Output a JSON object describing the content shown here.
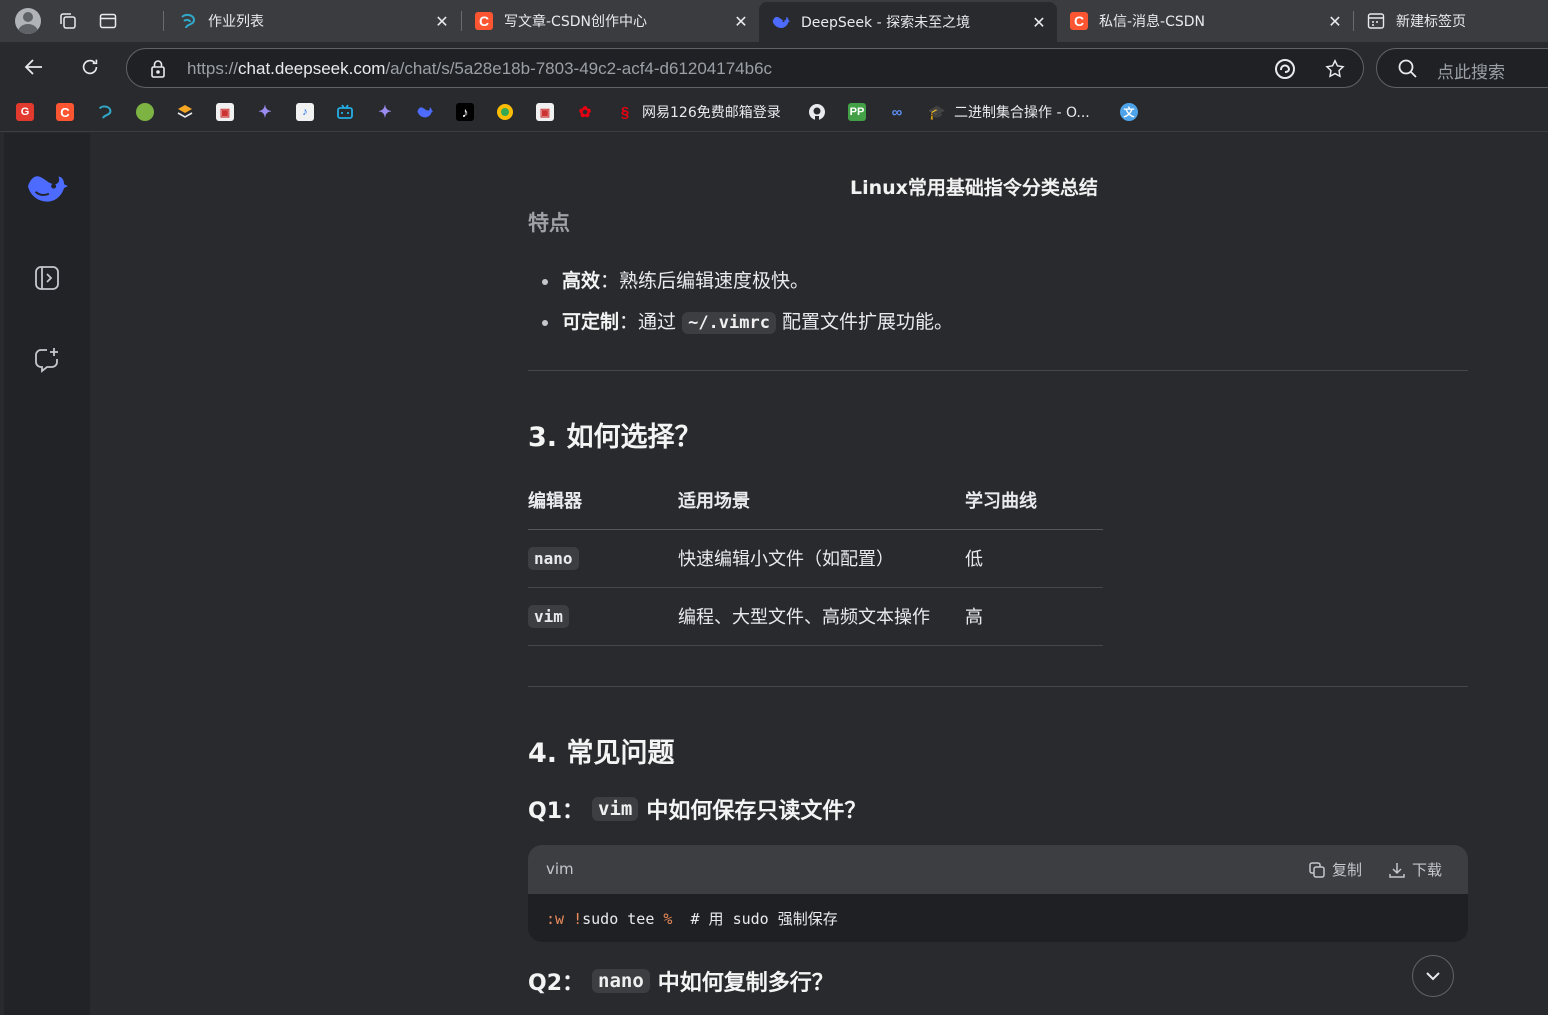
{
  "tabs": [
    {
      "title": "作业列表",
      "active": false
    },
    {
      "title": "写文章-CSDN创作中心",
      "active": false
    },
    {
      "title": "DeepSeek - 探索未至之境",
      "active": true
    },
    {
      "title": "私信-消息-CSDN",
      "active": false
    },
    {
      "title": "新建标签页",
      "active": false
    }
  ],
  "address_bar": {
    "url_scheme": "https://",
    "url_host": "chat.deepseek.com",
    "url_path": "/a/chat/s/5a28e18b-7803-49c2-acf4-d61204174b6c"
  },
  "search_box": {
    "placeholder": "点此搜索"
  },
  "bookmarks": {
    "netease_label": "网易126免费邮箱登录",
    "binary_label": "二进制集合操作 - O..."
  },
  "chat": {
    "title": "Linux常用基础指令分类总结",
    "features_heading": "特点",
    "bullet1_bold": "高效",
    "bullet1_text": "：熟练后编辑速度极快。",
    "bullet2_bold": "可定制",
    "bullet2_pre": "：通过",
    "bullet2_code": "~/.vimrc",
    "bullet2_post": "配置文件扩展功能。",
    "section3_title": "3. 如何选择？",
    "table": {
      "headers": [
        "编辑器",
        "适用场景",
        "学习曲线"
      ],
      "rows": [
        {
          "editor": "nano",
          "scenario": "快速编辑小文件（如配置）",
          "curve": "低"
        },
        {
          "editor": "vim",
          "scenario": "编程、大型文件、高频文本操作",
          "curve": "高"
        }
      ]
    },
    "section4_title": "4. 常见问题",
    "q1_prefix": "Q1：",
    "q1_code": "vim",
    "q1_suffix": "中如何保存只读文件？",
    "codeblock": {
      "lang": "vim",
      "copy_label": "复制",
      "download_label": "下载",
      "code_cmd": ":w",
      "code_bang": "!",
      "code_sudo": "sudo tee",
      "code_pct": "%",
      "code_comment": "# 用 sudo 强制保存"
    },
    "q2_prefix": "Q2：",
    "q2_code": "nano",
    "q2_suffix": "中如何复制多行？"
  },
  "colors": {
    "page_bg": "#292a2d",
    "sidebar_bg": "#212327",
    "deepseek_blue": "#4d6bfe",
    "csdn_red": "#fc5531"
  }
}
